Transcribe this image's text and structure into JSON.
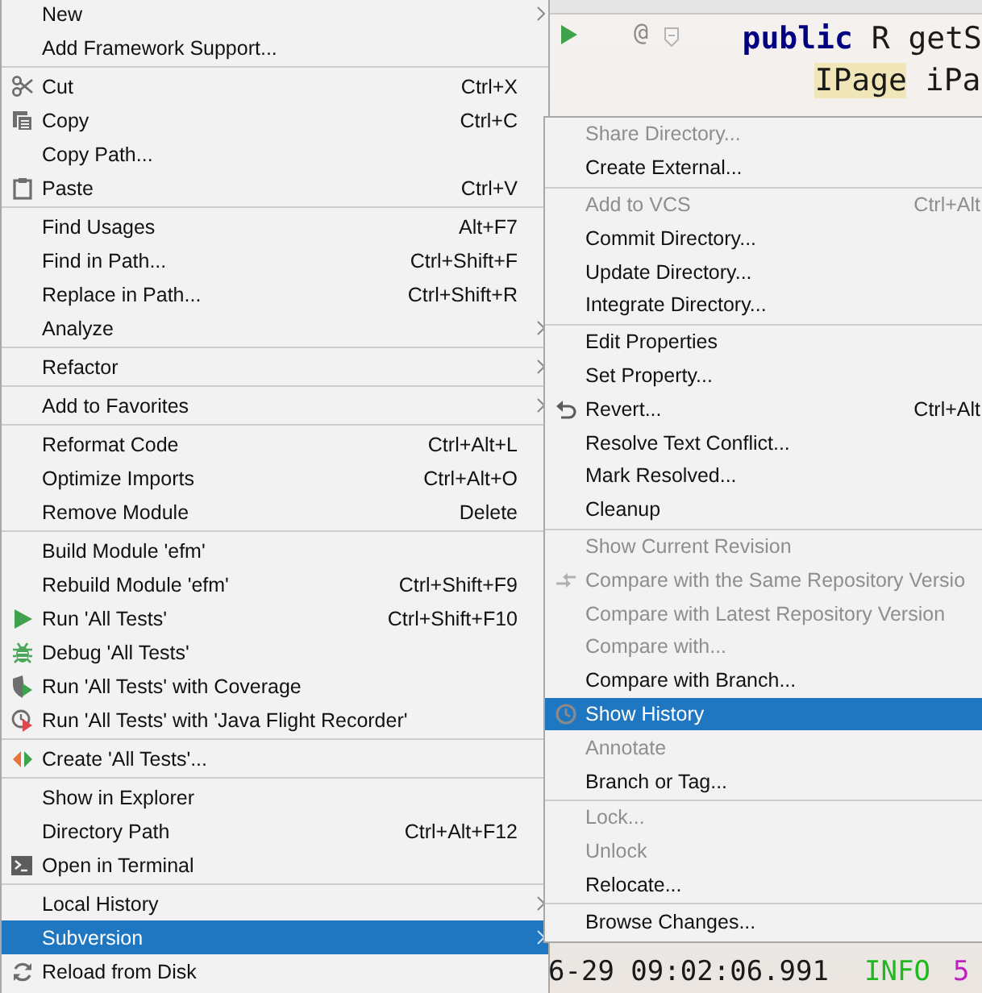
{
  "editor": {
    "code_lines": [
      {
        "tokens": [
          {
            "kind": "keyword",
            "text": "public"
          },
          {
            "kind": "plain",
            "text": " R getS"
          }
        ]
      },
      {
        "tokens": [
          {
            "kind": "highlight",
            "text": "IPage"
          },
          {
            "kind": "plain",
            "text": " iPa"
          }
        ]
      }
    ],
    "gutter": {
      "marker": "@"
    },
    "console_line": [
      {
        "kind": "plain",
        "text": "6-29 09:02:06.991"
      },
      {
        "kind": "info",
        "text": "INFO"
      },
      {
        "kind": "number",
        "text": "5"
      }
    ]
  },
  "menu": {
    "groups": [
      [
        {
          "label": "New",
          "submenu": true,
          "selected": false
        },
        {
          "label": "Add Framework Support...",
          "submenu": false,
          "selected": false
        }
      ],
      [
        {
          "label": "Cut",
          "shortcut": "Ctrl+X",
          "submenu": false,
          "selected": false
        },
        {
          "label": "Copy",
          "shortcut": "Ctrl+C",
          "submenu": false,
          "selected": false
        },
        {
          "label": "Copy Path...",
          "submenu": false,
          "selected": false
        },
        {
          "label": "Paste",
          "shortcut": "Ctrl+V",
          "submenu": false,
          "selected": false
        }
      ],
      [
        {
          "label": "Find Usages",
          "shortcut": "Alt+F7",
          "submenu": false,
          "selected": false
        },
        {
          "label": "Find in Path...",
          "shortcut": "Ctrl+Shift+F",
          "submenu": false,
          "selected": false
        },
        {
          "label": "Replace in Path...",
          "shortcut": "Ctrl+Shift+R",
          "submenu": false,
          "selected": false
        },
        {
          "label": "Analyze",
          "submenu": true,
          "selected": false
        }
      ],
      [
        {
          "label": "Refactor",
          "submenu": true,
          "selected": false
        }
      ],
      [
        {
          "label": "Add to Favorites",
          "submenu": true,
          "selected": false
        }
      ],
      [
        {
          "label": "Reformat Code",
          "shortcut": "Ctrl+Alt+L",
          "submenu": false,
          "selected": false
        },
        {
          "label": "Optimize Imports",
          "shortcut": "Ctrl+Alt+O",
          "submenu": false,
          "selected": false
        },
        {
          "label": "Remove Module",
          "shortcut": "Delete",
          "submenu": false,
          "selected": false
        }
      ],
      [
        {
          "label": "Build Module 'efm'",
          "submenu": false,
          "selected": false
        },
        {
          "label": "Rebuild Module 'efm'",
          "shortcut": "Ctrl+Shift+F9",
          "submenu": false,
          "selected": false
        },
        {
          "label": "Run 'All Tests'",
          "shortcut": "Ctrl+Shift+F10",
          "submenu": false,
          "selected": false
        },
        {
          "label": "Debug 'All Tests'",
          "submenu": false,
          "selected": false
        },
        {
          "label": "Run 'All Tests' with Coverage",
          "submenu": false,
          "selected": false
        },
        {
          "label": "Run 'All Tests' with 'Java Flight Recorder'",
          "submenu": false,
          "selected": false
        }
      ],
      [
        {
          "label": "Create 'All Tests'...",
          "submenu": false,
          "selected": false
        }
      ],
      [
        {
          "label": "Show in Explorer",
          "submenu": false,
          "selected": false
        },
        {
          "label": "Directory Path",
          "shortcut": "Ctrl+Alt+F12",
          "submenu": false,
          "selected": false
        },
        {
          "label": "Open in Terminal",
          "submenu": false,
          "selected": false
        }
      ],
      [
        {
          "label": "Local History",
          "submenu": true,
          "selected": false
        },
        {
          "label": "Subversion",
          "submenu": true,
          "selected": true
        },
        {
          "label": "Reload from Disk",
          "submenu": false,
          "selected": false
        }
      ]
    ]
  },
  "submenu": {
    "groups": [
      [
        {
          "label": "Share Directory...",
          "disabled": true,
          "selected": false
        },
        {
          "label": "Create External...",
          "disabled": false,
          "selected": false
        }
      ],
      [
        {
          "label": "Add to VCS",
          "shortcut": "Ctrl+Alt",
          "disabled": true,
          "selected": false
        },
        {
          "label": "Commit Directory...",
          "disabled": false,
          "selected": false
        },
        {
          "label": "Update Directory...",
          "disabled": false,
          "selected": false
        },
        {
          "label": "Integrate Directory...",
          "disabled": false,
          "selected": false
        }
      ],
      [
        {
          "label": "Edit Properties",
          "disabled": false,
          "selected": false
        },
        {
          "label": "Set Property...",
          "disabled": false,
          "selected": false
        },
        {
          "label": "Revert...",
          "shortcut": "Ctrl+Alt",
          "disabled": false,
          "selected": false
        },
        {
          "label": "Resolve Text Conflict...",
          "disabled": false,
          "selected": false
        },
        {
          "label": "Mark Resolved...",
          "disabled": false,
          "selected": false
        },
        {
          "label": "Cleanup",
          "disabled": false,
          "selected": false
        }
      ],
      [
        {
          "label": "Show Current Revision",
          "disabled": true,
          "selected": false
        },
        {
          "label": "Compare with the Same Repository Versio",
          "disabled": true,
          "selected": false
        },
        {
          "label": "Compare with Latest Repository Version",
          "disabled": true,
          "selected": false
        },
        {
          "label": "Compare with...",
          "disabled": true,
          "selected": false
        },
        {
          "label": "Compare with Branch...",
          "disabled": false,
          "selected": false
        },
        {
          "label": "Show History",
          "disabled": false,
          "selected": true
        },
        {
          "label": "Annotate",
          "disabled": true,
          "selected": false
        },
        {
          "label": "Branch or Tag...",
          "disabled": false,
          "selected": false
        }
      ],
      [
        {
          "label": "Lock...",
          "disabled": true,
          "selected": false
        },
        {
          "label": "Unlock",
          "disabled": true,
          "selected": false
        },
        {
          "label": "Relocate...",
          "disabled": false,
          "selected": false
        }
      ],
      [
        {
          "label": "Browse Changes...",
          "disabled": false,
          "selected": false
        }
      ]
    ]
  }
}
